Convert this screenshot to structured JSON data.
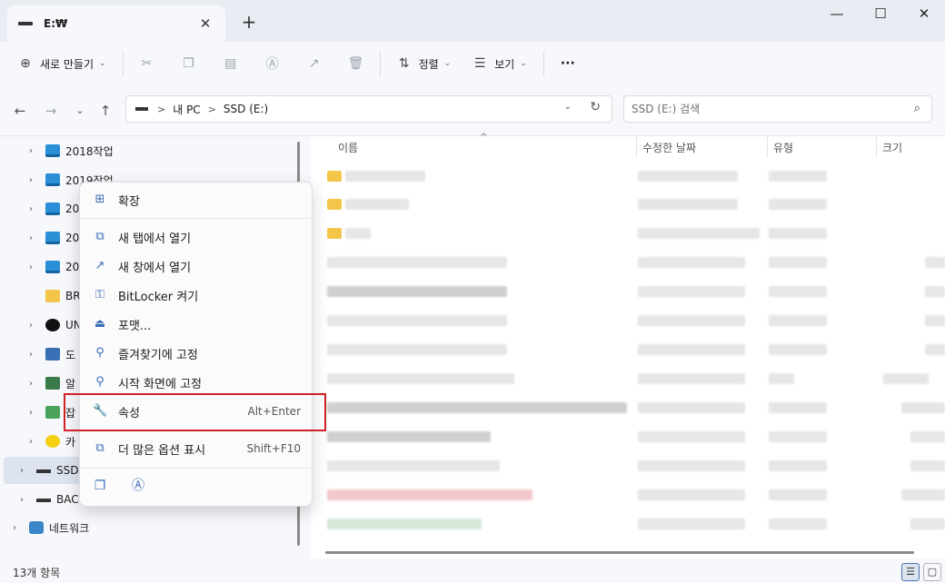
{
  "window": {
    "tab_title": "E:₩",
    "tab_close": "✕",
    "new_tab": "+",
    "minimize": "—",
    "maximize": "☐",
    "close": "✕"
  },
  "toolbar": {
    "new_label": "새로 만들기",
    "sort_label": "정렬",
    "view_label": "보기",
    "more_label": "···"
  },
  "address": {
    "crumbs": [
      "내 PC",
      "SSD (E:)"
    ],
    "separator": ">",
    "search_placeholder": "SSD (E:) 검색"
  },
  "sidebar": {
    "items": [
      {
        "label": "2018작업",
        "icon": "monitor-icon"
      },
      {
        "label": "2019작업",
        "icon": "monitor-icon"
      },
      {
        "label": "20",
        "icon": "monitor-icon"
      },
      {
        "label": "20",
        "icon": "monitor-icon"
      },
      {
        "label": "20",
        "icon": "monitor-icon"
      },
      {
        "label": "BR",
        "icon": "folder-icon"
      },
      {
        "label": "UN",
        "icon": "unreal-icon"
      },
      {
        "label": "도",
        "icon": "documents-icon"
      },
      {
        "label": "알",
        "icon": "printer-icon"
      },
      {
        "label": "잡",
        "icon": "share-icon"
      },
      {
        "label": "카",
        "icon": "kakao-icon"
      },
      {
        "label": "SSD",
        "icon": "drive-icon"
      },
      {
        "label": "BAC",
        "icon": "drive-icon"
      },
      {
        "label": "네트워크",
        "icon": "network-icon"
      }
    ]
  },
  "columns": {
    "name": "이름",
    "modified": "수정한 날짜",
    "type": "유형",
    "size": "크기"
  },
  "status": {
    "item_count": "13개 항목"
  },
  "context_menu": {
    "expand": "확장",
    "open_new_tab": "새 탭에서 열기",
    "open_new_window": "새 창에서 열기",
    "bitlocker": "BitLocker 켜기",
    "format": "포맷...",
    "pin_quick_access": "즐겨찾기에 고정",
    "pin_start": "시작 화면에 고정",
    "properties": "속성",
    "properties_shortcut": "Alt+Enter",
    "more_options": "더 많은 옵션 표시",
    "more_options_shortcut": "Shift+F10"
  }
}
